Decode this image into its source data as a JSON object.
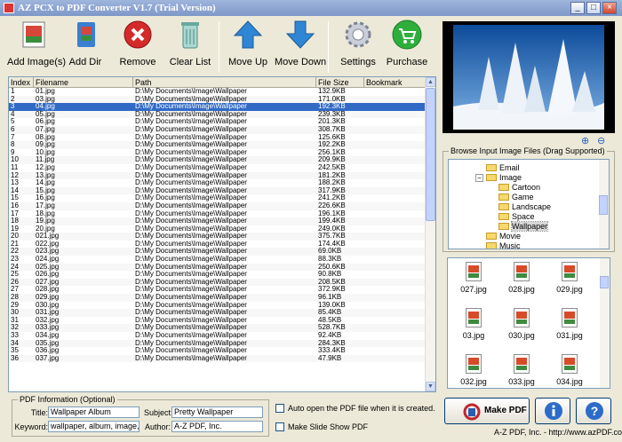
{
  "window": {
    "title": "AZ PCX to PDF Converter V1.7 (Trial Version)"
  },
  "toolbar": [
    {
      "label": "Add Image(s)",
      "icon": "add-image-icon"
    },
    {
      "label": "Add Dir",
      "icon": "add-dir-icon"
    },
    {
      "label": "Remove",
      "icon": "remove-icon"
    },
    {
      "label": "Clear List",
      "icon": "clear-list-icon"
    },
    {
      "label": "Move Up",
      "icon": "move-up-icon"
    },
    {
      "label": "Move Down",
      "icon": "move-down-icon"
    },
    {
      "label": "Settings",
      "icon": "settings-icon"
    },
    {
      "label": "Purchase",
      "icon": "purchase-icon"
    }
  ],
  "grid": {
    "columns": [
      "Index",
      "Filename",
      "Path",
      "File Size",
      "Bookmark"
    ],
    "selected_index": 2,
    "rows": [
      [
        "1",
        "01.jpg",
        "D:\\My Documents\\Image\\Wallpaper",
        "132.9KB",
        ""
      ],
      [
        "2",
        "03.jpg",
        "D:\\My Documents\\Image\\Wallpaper",
        "171.0KB",
        ""
      ],
      [
        "3",
        "04.jpg",
        "D:\\My Documents\\Image\\Wallpaper",
        "192.3KB",
        ""
      ],
      [
        "4",
        "05.jpg",
        "D:\\My Documents\\Image\\Wallpaper",
        "239.3KB",
        ""
      ],
      [
        "5",
        "06.jpg",
        "D:\\My Documents\\Image\\Wallpaper",
        "201.3KB",
        ""
      ],
      [
        "6",
        "07.jpg",
        "D:\\My Documents\\Image\\Wallpaper",
        "308.7KB",
        ""
      ],
      [
        "7",
        "08.jpg",
        "D:\\My Documents\\Image\\Wallpaper",
        "125.6KB",
        ""
      ],
      [
        "8",
        "09.jpg",
        "D:\\My Documents\\Image\\Wallpaper",
        "192.2KB",
        ""
      ],
      [
        "9",
        "10.jpg",
        "D:\\My Documents\\Image\\Wallpaper",
        "256.1KB",
        ""
      ],
      [
        "10",
        "11.jpg",
        "D:\\My Documents\\Image\\Wallpaper",
        "209.9KB",
        ""
      ],
      [
        "11",
        "12.jpg",
        "D:\\My Documents\\Image\\Wallpaper",
        "242.5KB",
        ""
      ],
      [
        "12",
        "13.jpg",
        "D:\\My Documents\\Image\\Wallpaper",
        "181.2KB",
        ""
      ],
      [
        "13",
        "14.jpg",
        "D:\\My Documents\\Image\\Wallpaper",
        "188.2KB",
        ""
      ],
      [
        "14",
        "15.jpg",
        "D:\\My Documents\\Image\\Wallpaper",
        "317.9KB",
        ""
      ],
      [
        "15",
        "16.jpg",
        "D:\\My Documents\\Image\\Wallpaper",
        "241.2KB",
        ""
      ],
      [
        "16",
        "17.jpg",
        "D:\\My Documents\\Image\\Wallpaper",
        "226.6KB",
        ""
      ],
      [
        "17",
        "18.jpg",
        "D:\\My Documents\\Image\\Wallpaper",
        "196.1KB",
        ""
      ],
      [
        "18",
        "19.jpg",
        "D:\\My Documents\\Image\\Wallpaper",
        "199.4KB",
        ""
      ],
      [
        "19",
        "20.jpg",
        "D:\\My Documents\\Image\\Wallpaper",
        "249.0KB",
        ""
      ],
      [
        "20",
        "021.jpg",
        "D:\\My Documents\\Image\\Wallpaper",
        "375.7KB",
        ""
      ],
      [
        "21",
        "022.jpg",
        "D:\\My Documents\\Image\\Wallpaper",
        "174.4KB",
        ""
      ],
      [
        "22",
        "023.jpg",
        "D:\\My Documents\\Image\\Wallpaper",
        "69.0KB",
        ""
      ],
      [
        "23",
        "024.jpg",
        "D:\\My Documents\\Image\\Wallpaper",
        "88.3KB",
        ""
      ],
      [
        "24",
        "025.jpg",
        "D:\\My Documents\\Image\\Wallpaper",
        "250.6KB",
        ""
      ],
      [
        "25",
        "026.jpg",
        "D:\\My Documents\\Image\\Wallpaper",
        "90.8KB",
        ""
      ],
      [
        "26",
        "027.jpg",
        "D:\\My Documents\\Image\\Wallpaper",
        "208.5KB",
        ""
      ],
      [
        "27",
        "028.jpg",
        "D:\\My Documents\\Image\\Wallpaper",
        "372.9KB",
        ""
      ],
      [
        "28",
        "029.jpg",
        "D:\\My Documents\\Image\\Wallpaper",
        "96.1KB",
        ""
      ],
      [
        "29",
        "030.jpg",
        "D:\\My Documents\\Image\\Wallpaper",
        "139.0KB",
        ""
      ],
      [
        "30",
        "031.jpg",
        "D:\\My Documents\\Image\\Wallpaper",
        "85.4KB",
        ""
      ],
      [
        "31",
        "032.jpg",
        "D:\\My Documents\\Image\\Wallpaper",
        "48.5KB",
        ""
      ],
      [
        "32",
        "033.jpg",
        "D:\\My Documents\\Image\\Wallpaper",
        "528.7KB",
        ""
      ],
      [
        "33",
        "034.jpg",
        "D:\\My Documents\\Image\\Wallpaper",
        "92.4KB",
        ""
      ],
      [
        "34",
        "035.jpg",
        "D:\\My Documents\\Image\\Wallpaper",
        "284.3KB",
        ""
      ],
      [
        "35",
        "036.jpg",
        "D:\\My Documents\\Image\\Wallpaper",
        "333.4KB",
        ""
      ],
      [
        "36",
        "037.jpg",
        "D:\\My Documents\\Image\\Wallpaper",
        "47.9KB",
        ""
      ]
    ]
  },
  "browser": {
    "title": "Browse Input Image Files (Drag Supported)",
    "tree": [
      {
        "label": "Email",
        "level": 1,
        "expander": ""
      },
      {
        "label": "Image",
        "level": 1,
        "expander": "−"
      },
      {
        "label": "Cartoon",
        "level": 2,
        "expander": ""
      },
      {
        "label": "Game",
        "level": 2,
        "expander": ""
      },
      {
        "label": "Landscape",
        "level": 2,
        "expander": ""
      },
      {
        "label": "Space",
        "level": 2,
        "expander": ""
      },
      {
        "label": "Wallpaper",
        "level": 2,
        "expander": "",
        "selected": true
      },
      {
        "label": "Movie",
        "level": 1,
        "expander": ""
      },
      {
        "label": "Music",
        "level": 1,
        "expander": ""
      }
    ],
    "thumbnails": [
      "027.jpg",
      "028.jpg",
      "029.jpg",
      "03.jpg",
      "030.jpg",
      "031.jpg",
      "032.jpg",
      "033.jpg",
      "034.jpg"
    ]
  },
  "pdf_info": {
    "legend": "PDF Information (Optional)",
    "title_label": "Title:",
    "title_value": "Wallpaper Album",
    "keyword_label": "Keyword:",
    "keyword_value": "wallpaper, album, image, pdf",
    "subject_label": "Subject:",
    "subject_value": "Pretty Wallpaper",
    "author_label": "Author:",
    "author_value": "A-Z PDF, Inc."
  },
  "options": {
    "auto_open_label": "Auto open the PDF file when it is created.",
    "slide_show_label": "Make Slide Show PDF"
  },
  "actions": {
    "make_pdf": "Make PDF"
  },
  "footer": "A-Z PDF, Inc. - http://www.azPDF.com",
  "colors": {
    "selection": "#316ac5",
    "title_bar": "#7d97c8"
  }
}
